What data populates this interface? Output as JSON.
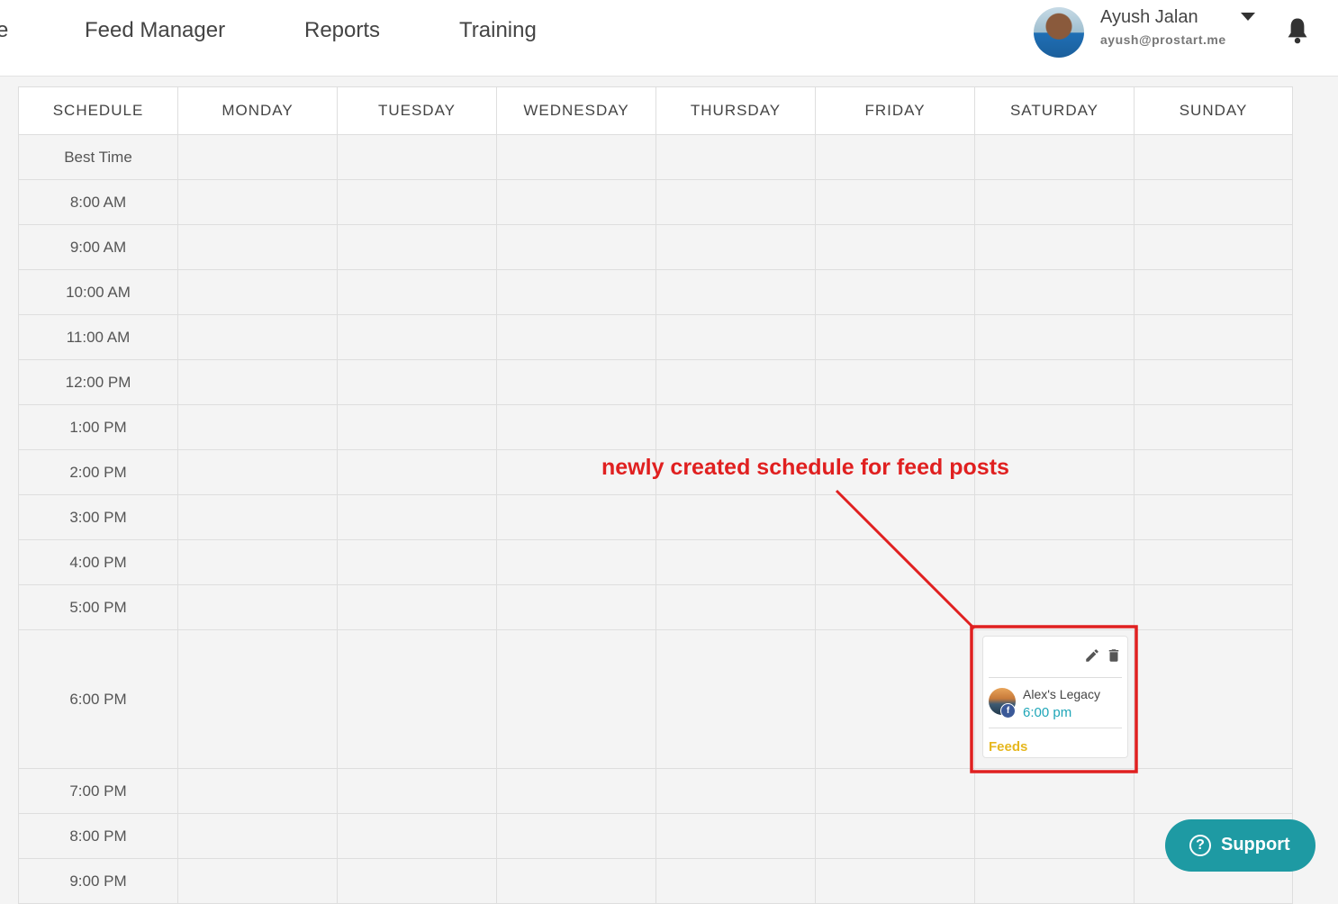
{
  "nav": {
    "partial_item": "e",
    "items": [
      {
        "label": "Feed Manager"
      },
      {
        "label": "Reports"
      },
      {
        "label": "Training"
      }
    ]
  },
  "user": {
    "name": "Ayush Jalan",
    "email": "ayush@prostart.me"
  },
  "schedule": {
    "headers": [
      "SCHEDULE",
      "MONDAY",
      "TUESDAY",
      "WEDNESDAY",
      "THURSDAY",
      "FRIDAY",
      "SATURDAY",
      "SUNDAY"
    ],
    "rows": [
      "Best Time",
      "8:00 AM",
      "9:00 AM",
      "10:00 AM",
      "11:00 AM",
      "12:00 PM",
      "1:00 PM",
      "2:00 PM",
      "3:00 PM",
      "4:00 PM",
      "5:00 PM",
      "6:00 PM",
      "7:00 PM",
      "8:00 PM",
      "9:00 PM"
    ],
    "card": {
      "day": "SATURDAY",
      "row": "6:00 PM",
      "page": "Alex's Legacy",
      "time": "6:00 pm",
      "type": "Feeds",
      "network_badge": "f"
    }
  },
  "annotation": {
    "text": "newly created schedule for feed posts",
    "color": "#e02020"
  },
  "support": {
    "label": "Support",
    "icon": "?"
  },
  "colors": {
    "accent_teal": "#1e9aa3",
    "time_teal": "#1fa6b8",
    "feeds_yellow": "#e6b71e",
    "facebook_blue": "#3b5998"
  }
}
